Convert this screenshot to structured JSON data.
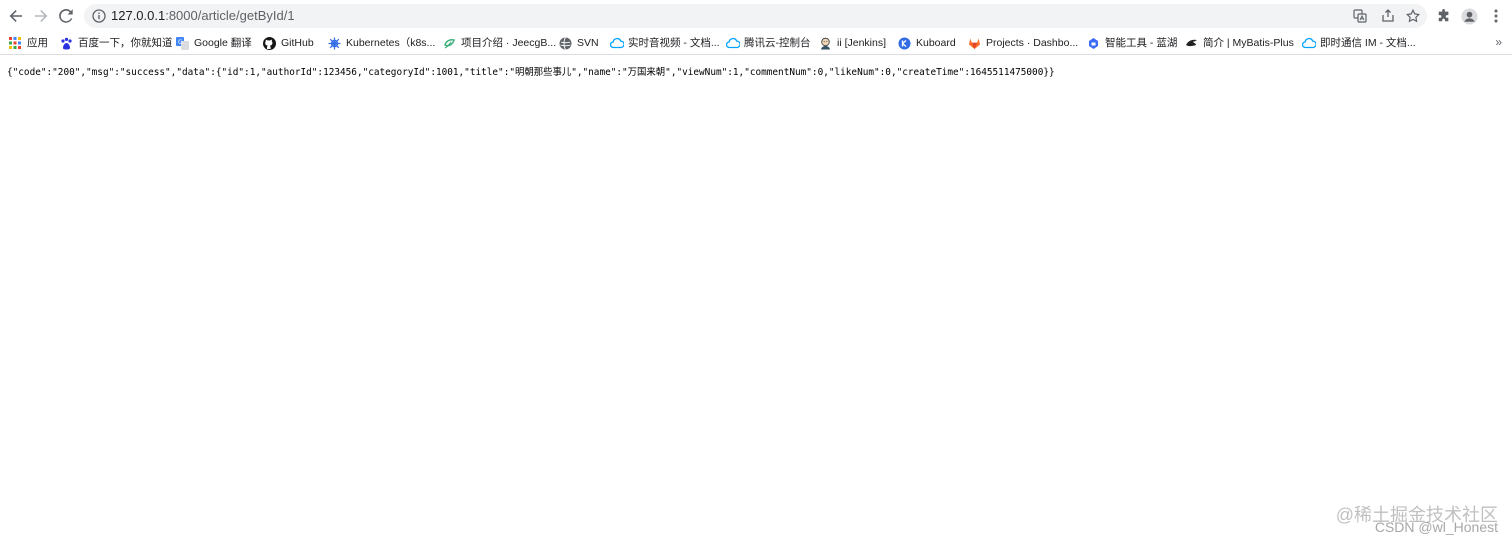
{
  "address_bar": {
    "host": "127.0.0.1",
    "path": ":8000/article/getById/1"
  },
  "toolbar": {
    "icons": [
      "back-icon",
      "forward-icon",
      "reload-icon",
      "info-icon",
      "translate-icon",
      "share-icon",
      "star-icon",
      "extensions-icon",
      "profile-icon",
      "menu-icon"
    ]
  },
  "bookmarks": [
    {
      "label": "应用",
      "icon": "apps-grid-icon"
    },
    {
      "label": "百度一下，你就知道",
      "icon": "baidu-icon"
    },
    {
      "label": "Google 翻译",
      "icon": "google-translate-icon"
    },
    {
      "label": "GitHub",
      "icon": "github-icon"
    },
    {
      "label": "Kubernetes（k8s...",
      "icon": "kubernetes-icon"
    },
    {
      "label": "项目介绍 · JeecgB...",
      "icon": "jeecg-icon"
    },
    {
      "label": "SVN",
      "icon": "svn-icon"
    },
    {
      "label": "实时音视频 - 文档...",
      "icon": "cloud-icon"
    },
    {
      "label": "腾讯云-控制台",
      "icon": "cloud-icon"
    },
    {
      "label": "ii [Jenkins]",
      "icon": "jenkins-icon"
    },
    {
      "label": "Kuboard",
      "icon": "kuboard-icon"
    },
    {
      "label": "Projects · Dashbo...",
      "icon": "gitlab-icon"
    },
    {
      "label": "智能工具 - 蓝湖",
      "icon": "lanhu-icon"
    },
    {
      "label": "简介 | MyBatis-Plus",
      "icon": "mybatis-icon"
    },
    {
      "label": "即时通信 IM - 文档...",
      "icon": "cloud-icon"
    }
  ],
  "bookmarks_more": "»",
  "body_text": "{\"code\":\"200\",\"msg\":\"success\",\"data\":{\"id\":1,\"authorId\":123456,\"categoryId\":1001,\"title\":\"明朝那些事儿\",\"name\":\"万国来朝\",\"viewNum\":1,\"commentNum\":0,\"likeNum\":0,\"createTime\":1645511475000}}",
  "watermark": {
    "line1": "@稀土掘金技术社区",
    "line2": "CSDN @wl_Honest"
  }
}
